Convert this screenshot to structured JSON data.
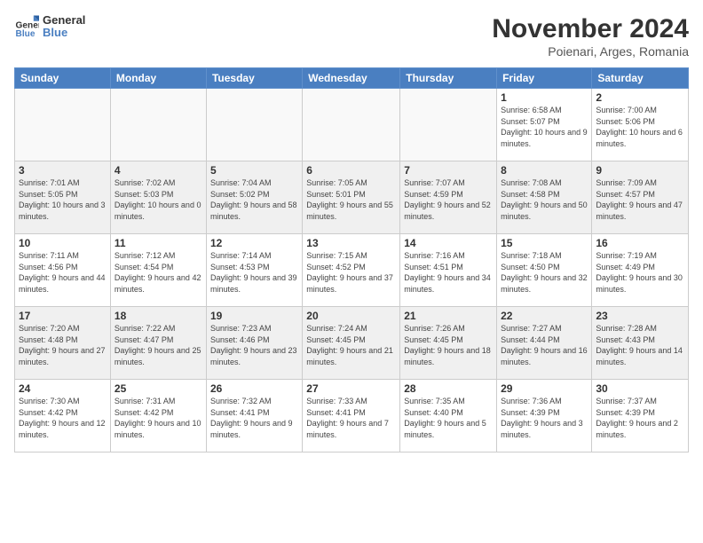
{
  "header": {
    "logo_general": "General",
    "logo_blue": "Blue",
    "month_title": "November 2024",
    "subtitle": "Poienari, Arges, Romania"
  },
  "weekdays": [
    "Sunday",
    "Monday",
    "Tuesday",
    "Wednesday",
    "Thursday",
    "Friday",
    "Saturday"
  ],
  "weeks": [
    [
      {
        "day": "",
        "info": ""
      },
      {
        "day": "",
        "info": ""
      },
      {
        "day": "",
        "info": ""
      },
      {
        "day": "",
        "info": ""
      },
      {
        "day": "",
        "info": ""
      },
      {
        "day": "1",
        "info": "Sunrise: 6:58 AM\nSunset: 5:07 PM\nDaylight: 10 hours and 9 minutes."
      },
      {
        "day": "2",
        "info": "Sunrise: 7:00 AM\nSunset: 5:06 PM\nDaylight: 10 hours and 6 minutes."
      }
    ],
    [
      {
        "day": "3",
        "info": "Sunrise: 7:01 AM\nSunset: 5:05 PM\nDaylight: 10 hours and 3 minutes."
      },
      {
        "day": "4",
        "info": "Sunrise: 7:02 AM\nSunset: 5:03 PM\nDaylight: 10 hours and 0 minutes."
      },
      {
        "day": "5",
        "info": "Sunrise: 7:04 AM\nSunset: 5:02 PM\nDaylight: 9 hours and 58 minutes."
      },
      {
        "day": "6",
        "info": "Sunrise: 7:05 AM\nSunset: 5:01 PM\nDaylight: 9 hours and 55 minutes."
      },
      {
        "day": "7",
        "info": "Sunrise: 7:07 AM\nSunset: 4:59 PM\nDaylight: 9 hours and 52 minutes."
      },
      {
        "day": "8",
        "info": "Sunrise: 7:08 AM\nSunset: 4:58 PM\nDaylight: 9 hours and 50 minutes."
      },
      {
        "day": "9",
        "info": "Sunrise: 7:09 AM\nSunset: 4:57 PM\nDaylight: 9 hours and 47 minutes."
      }
    ],
    [
      {
        "day": "10",
        "info": "Sunrise: 7:11 AM\nSunset: 4:56 PM\nDaylight: 9 hours and 44 minutes."
      },
      {
        "day": "11",
        "info": "Sunrise: 7:12 AM\nSunset: 4:54 PM\nDaylight: 9 hours and 42 minutes."
      },
      {
        "day": "12",
        "info": "Sunrise: 7:14 AM\nSunset: 4:53 PM\nDaylight: 9 hours and 39 minutes."
      },
      {
        "day": "13",
        "info": "Sunrise: 7:15 AM\nSunset: 4:52 PM\nDaylight: 9 hours and 37 minutes."
      },
      {
        "day": "14",
        "info": "Sunrise: 7:16 AM\nSunset: 4:51 PM\nDaylight: 9 hours and 34 minutes."
      },
      {
        "day": "15",
        "info": "Sunrise: 7:18 AM\nSunset: 4:50 PM\nDaylight: 9 hours and 32 minutes."
      },
      {
        "day": "16",
        "info": "Sunrise: 7:19 AM\nSunset: 4:49 PM\nDaylight: 9 hours and 30 minutes."
      }
    ],
    [
      {
        "day": "17",
        "info": "Sunrise: 7:20 AM\nSunset: 4:48 PM\nDaylight: 9 hours and 27 minutes."
      },
      {
        "day": "18",
        "info": "Sunrise: 7:22 AM\nSunset: 4:47 PM\nDaylight: 9 hours and 25 minutes."
      },
      {
        "day": "19",
        "info": "Sunrise: 7:23 AM\nSunset: 4:46 PM\nDaylight: 9 hours and 23 minutes."
      },
      {
        "day": "20",
        "info": "Sunrise: 7:24 AM\nSunset: 4:45 PM\nDaylight: 9 hours and 21 minutes."
      },
      {
        "day": "21",
        "info": "Sunrise: 7:26 AM\nSunset: 4:45 PM\nDaylight: 9 hours and 18 minutes."
      },
      {
        "day": "22",
        "info": "Sunrise: 7:27 AM\nSunset: 4:44 PM\nDaylight: 9 hours and 16 minutes."
      },
      {
        "day": "23",
        "info": "Sunrise: 7:28 AM\nSunset: 4:43 PM\nDaylight: 9 hours and 14 minutes."
      }
    ],
    [
      {
        "day": "24",
        "info": "Sunrise: 7:30 AM\nSunset: 4:42 PM\nDaylight: 9 hours and 12 minutes."
      },
      {
        "day": "25",
        "info": "Sunrise: 7:31 AM\nSunset: 4:42 PM\nDaylight: 9 hours and 10 minutes."
      },
      {
        "day": "26",
        "info": "Sunrise: 7:32 AM\nSunset: 4:41 PM\nDaylight: 9 hours and 9 minutes."
      },
      {
        "day": "27",
        "info": "Sunrise: 7:33 AM\nSunset: 4:41 PM\nDaylight: 9 hours and 7 minutes."
      },
      {
        "day": "28",
        "info": "Sunrise: 7:35 AM\nSunset: 4:40 PM\nDaylight: 9 hours and 5 minutes."
      },
      {
        "day": "29",
        "info": "Sunrise: 7:36 AM\nSunset: 4:39 PM\nDaylight: 9 hours and 3 minutes."
      },
      {
        "day": "30",
        "info": "Sunrise: 7:37 AM\nSunset: 4:39 PM\nDaylight: 9 hours and 2 minutes."
      }
    ]
  ]
}
